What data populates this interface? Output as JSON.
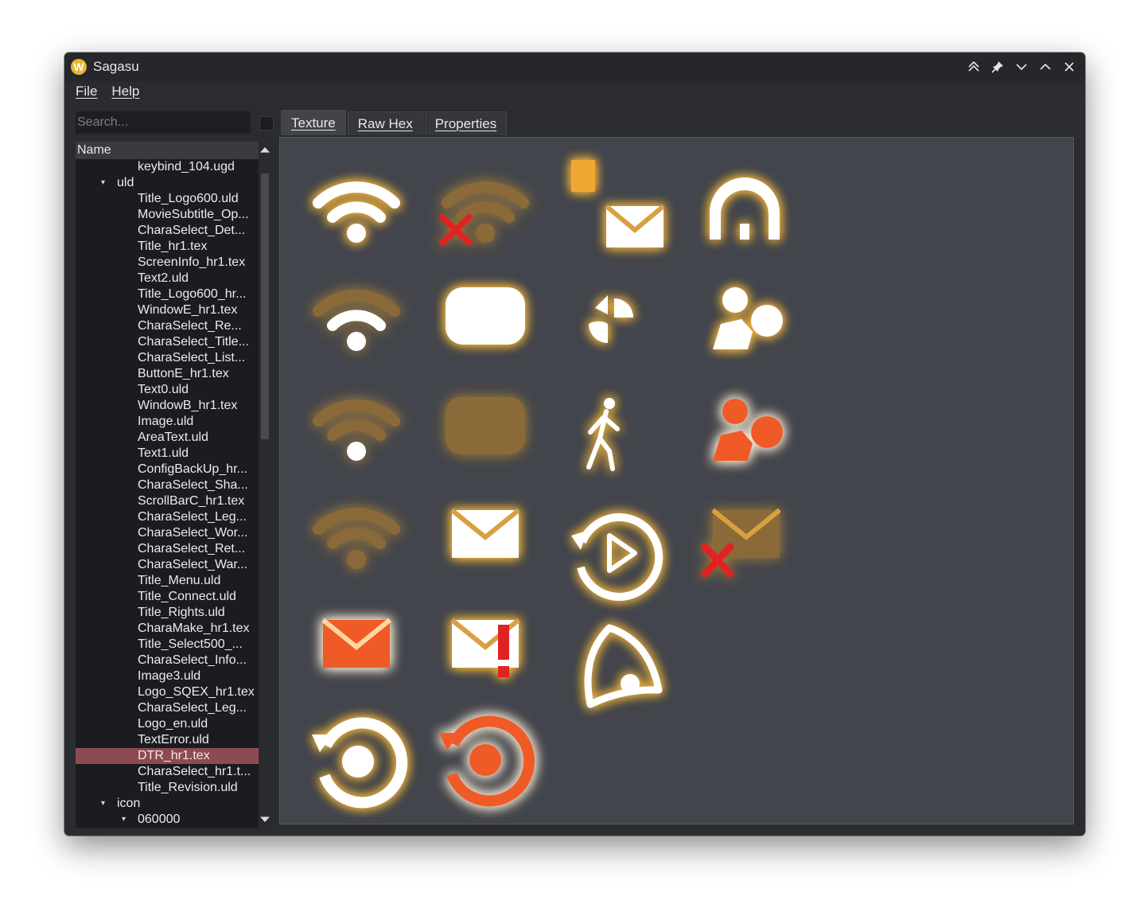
{
  "window": {
    "title": "Sagasu",
    "app_icon": "W"
  },
  "menu": {
    "file": "File",
    "help": "Help"
  },
  "search": {
    "placeholder": "Search..."
  },
  "tree": {
    "header": "Name",
    "rows": [
      {
        "label": "keybind_104.ugd",
        "level": 2,
        "arrow": ""
      },
      {
        "label": "uld",
        "level": 1,
        "arrow": "down"
      },
      {
        "label": "Title_Logo600.uld",
        "level": 2,
        "arrow": ""
      },
      {
        "label": "MovieSubtitle_Op...",
        "level": 2,
        "arrow": ""
      },
      {
        "label": "CharaSelect_Det...",
        "level": 2,
        "arrow": ""
      },
      {
        "label": "Title_hr1.tex",
        "level": 2,
        "arrow": ""
      },
      {
        "label": "ScreenInfo_hr1.tex",
        "level": 2,
        "arrow": ""
      },
      {
        "label": "Text2.uld",
        "level": 2,
        "arrow": ""
      },
      {
        "label": "Title_Logo600_hr...",
        "level": 2,
        "arrow": ""
      },
      {
        "label": "WindowE_hr1.tex",
        "level": 2,
        "arrow": ""
      },
      {
        "label": "CharaSelect_Re...",
        "level": 2,
        "arrow": ""
      },
      {
        "label": "CharaSelect_Title...",
        "level": 2,
        "arrow": ""
      },
      {
        "label": "CharaSelect_List...",
        "level": 2,
        "arrow": ""
      },
      {
        "label": "ButtonE_hr1.tex",
        "level": 2,
        "arrow": ""
      },
      {
        "label": "Text0.uld",
        "level": 2,
        "arrow": ""
      },
      {
        "label": "WindowB_hr1.tex",
        "level": 2,
        "arrow": ""
      },
      {
        "label": "Image.uld",
        "level": 2,
        "arrow": ""
      },
      {
        "label": "AreaText.uld",
        "level": 2,
        "arrow": ""
      },
      {
        "label": "Text1.uld",
        "level": 2,
        "arrow": ""
      },
      {
        "label": "ConfigBackUp_hr...",
        "level": 2,
        "arrow": ""
      },
      {
        "label": "CharaSelect_Sha...",
        "level": 2,
        "arrow": ""
      },
      {
        "label": "ScrollBarC_hr1.tex",
        "level": 2,
        "arrow": ""
      },
      {
        "label": "CharaSelect_Leg...",
        "level": 2,
        "arrow": ""
      },
      {
        "label": "CharaSelect_Wor...",
        "level": 2,
        "arrow": ""
      },
      {
        "label": "CharaSelect_Ret...",
        "level": 2,
        "arrow": ""
      },
      {
        "label": "CharaSelect_War...",
        "level": 2,
        "arrow": ""
      },
      {
        "label": "Title_Menu.uld",
        "level": 2,
        "arrow": ""
      },
      {
        "label": "Title_Connect.uld",
        "level": 2,
        "arrow": ""
      },
      {
        "label": "Title_Rights.uld",
        "level": 2,
        "arrow": ""
      },
      {
        "label": "CharaMake_hr1.tex",
        "level": 2,
        "arrow": ""
      },
      {
        "label": "Title_Select500_...",
        "level": 2,
        "arrow": ""
      },
      {
        "label": "CharaSelect_Info...",
        "level": 2,
        "arrow": ""
      },
      {
        "label": "Image3.uld",
        "level": 2,
        "arrow": ""
      },
      {
        "label": "Logo_SQEX_hr1.tex",
        "level": 2,
        "arrow": ""
      },
      {
        "label": "CharaSelect_Leg...",
        "level": 2,
        "arrow": ""
      },
      {
        "label": "Logo_en.uld",
        "level": 2,
        "arrow": ""
      },
      {
        "label": "TextError.uld",
        "level": 2,
        "arrow": ""
      },
      {
        "label": "DTR_hr1.tex",
        "level": 2,
        "arrow": "",
        "selected": true
      },
      {
        "label": "CharaSelect_hr1.t...",
        "level": 2,
        "arrow": ""
      },
      {
        "label": "Title_Revision.uld",
        "level": 2,
        "arrow": ""
      },
      {
        "label": "icon",
        "level": 1,
        "arrow": "down"
      },
      {
        "label": "060000",
        "level": 2,
        "arrow": "down"
      }
    ]
  },
  "tabs": [
    {
      "label": "Texture",
      "active": true
    },
    {
      "label": "Raw Hex",
      "active": false
    },
    {
      "label": "Properties",
      "active": false
    }
  ],
  "texture": {
    "glow_color": "#f0b640",
    "icon_white": "#ffffff",
    "icon_dim": "#8a6a38",
    "icon_orange": "#f05a28",
    "error_red": "#e02020",
    "sprites": [
      {
        "name": "wifi-full-icon"
      },
      {
        "name": "wifi-disconnected-icon"
      },
      {
        "name": "mail-document-icon"
      },
      {
        "name": "home-icon"
      },
      {
        "name": "wifi-medium-icon"
      },
      {
        "name": "rounded-box-icon"
      },
      {
        "name": "pie-segments-icon"
      },
      {
        "name": "character-icon"
      },
      {
        "name": "wifi-low-icon"
      },
      {
        "name": "rounded-box-dim-icon"
      },
      {
        "name": "walking-person-icon"
      },
      {
        "name": "character-orange-icon"
      },
      {
        "name": "wifi-none-icon"
      },
      {
        "name": "mail-icon"
      },
      {
        "name": "replay-icon"
      },
      {
        "name": "mail-error-icon"
      },
      {
        "name": "mail-orange-icon"
      },
      {
        "name": "mail-alert-icon"
      },
      {
        "name": "bell-icon"
      },
      {
        "name": "refresh-icon"
      },
      {
        "name": "refresh-orange-icon"
      }
    ]
  }
}
